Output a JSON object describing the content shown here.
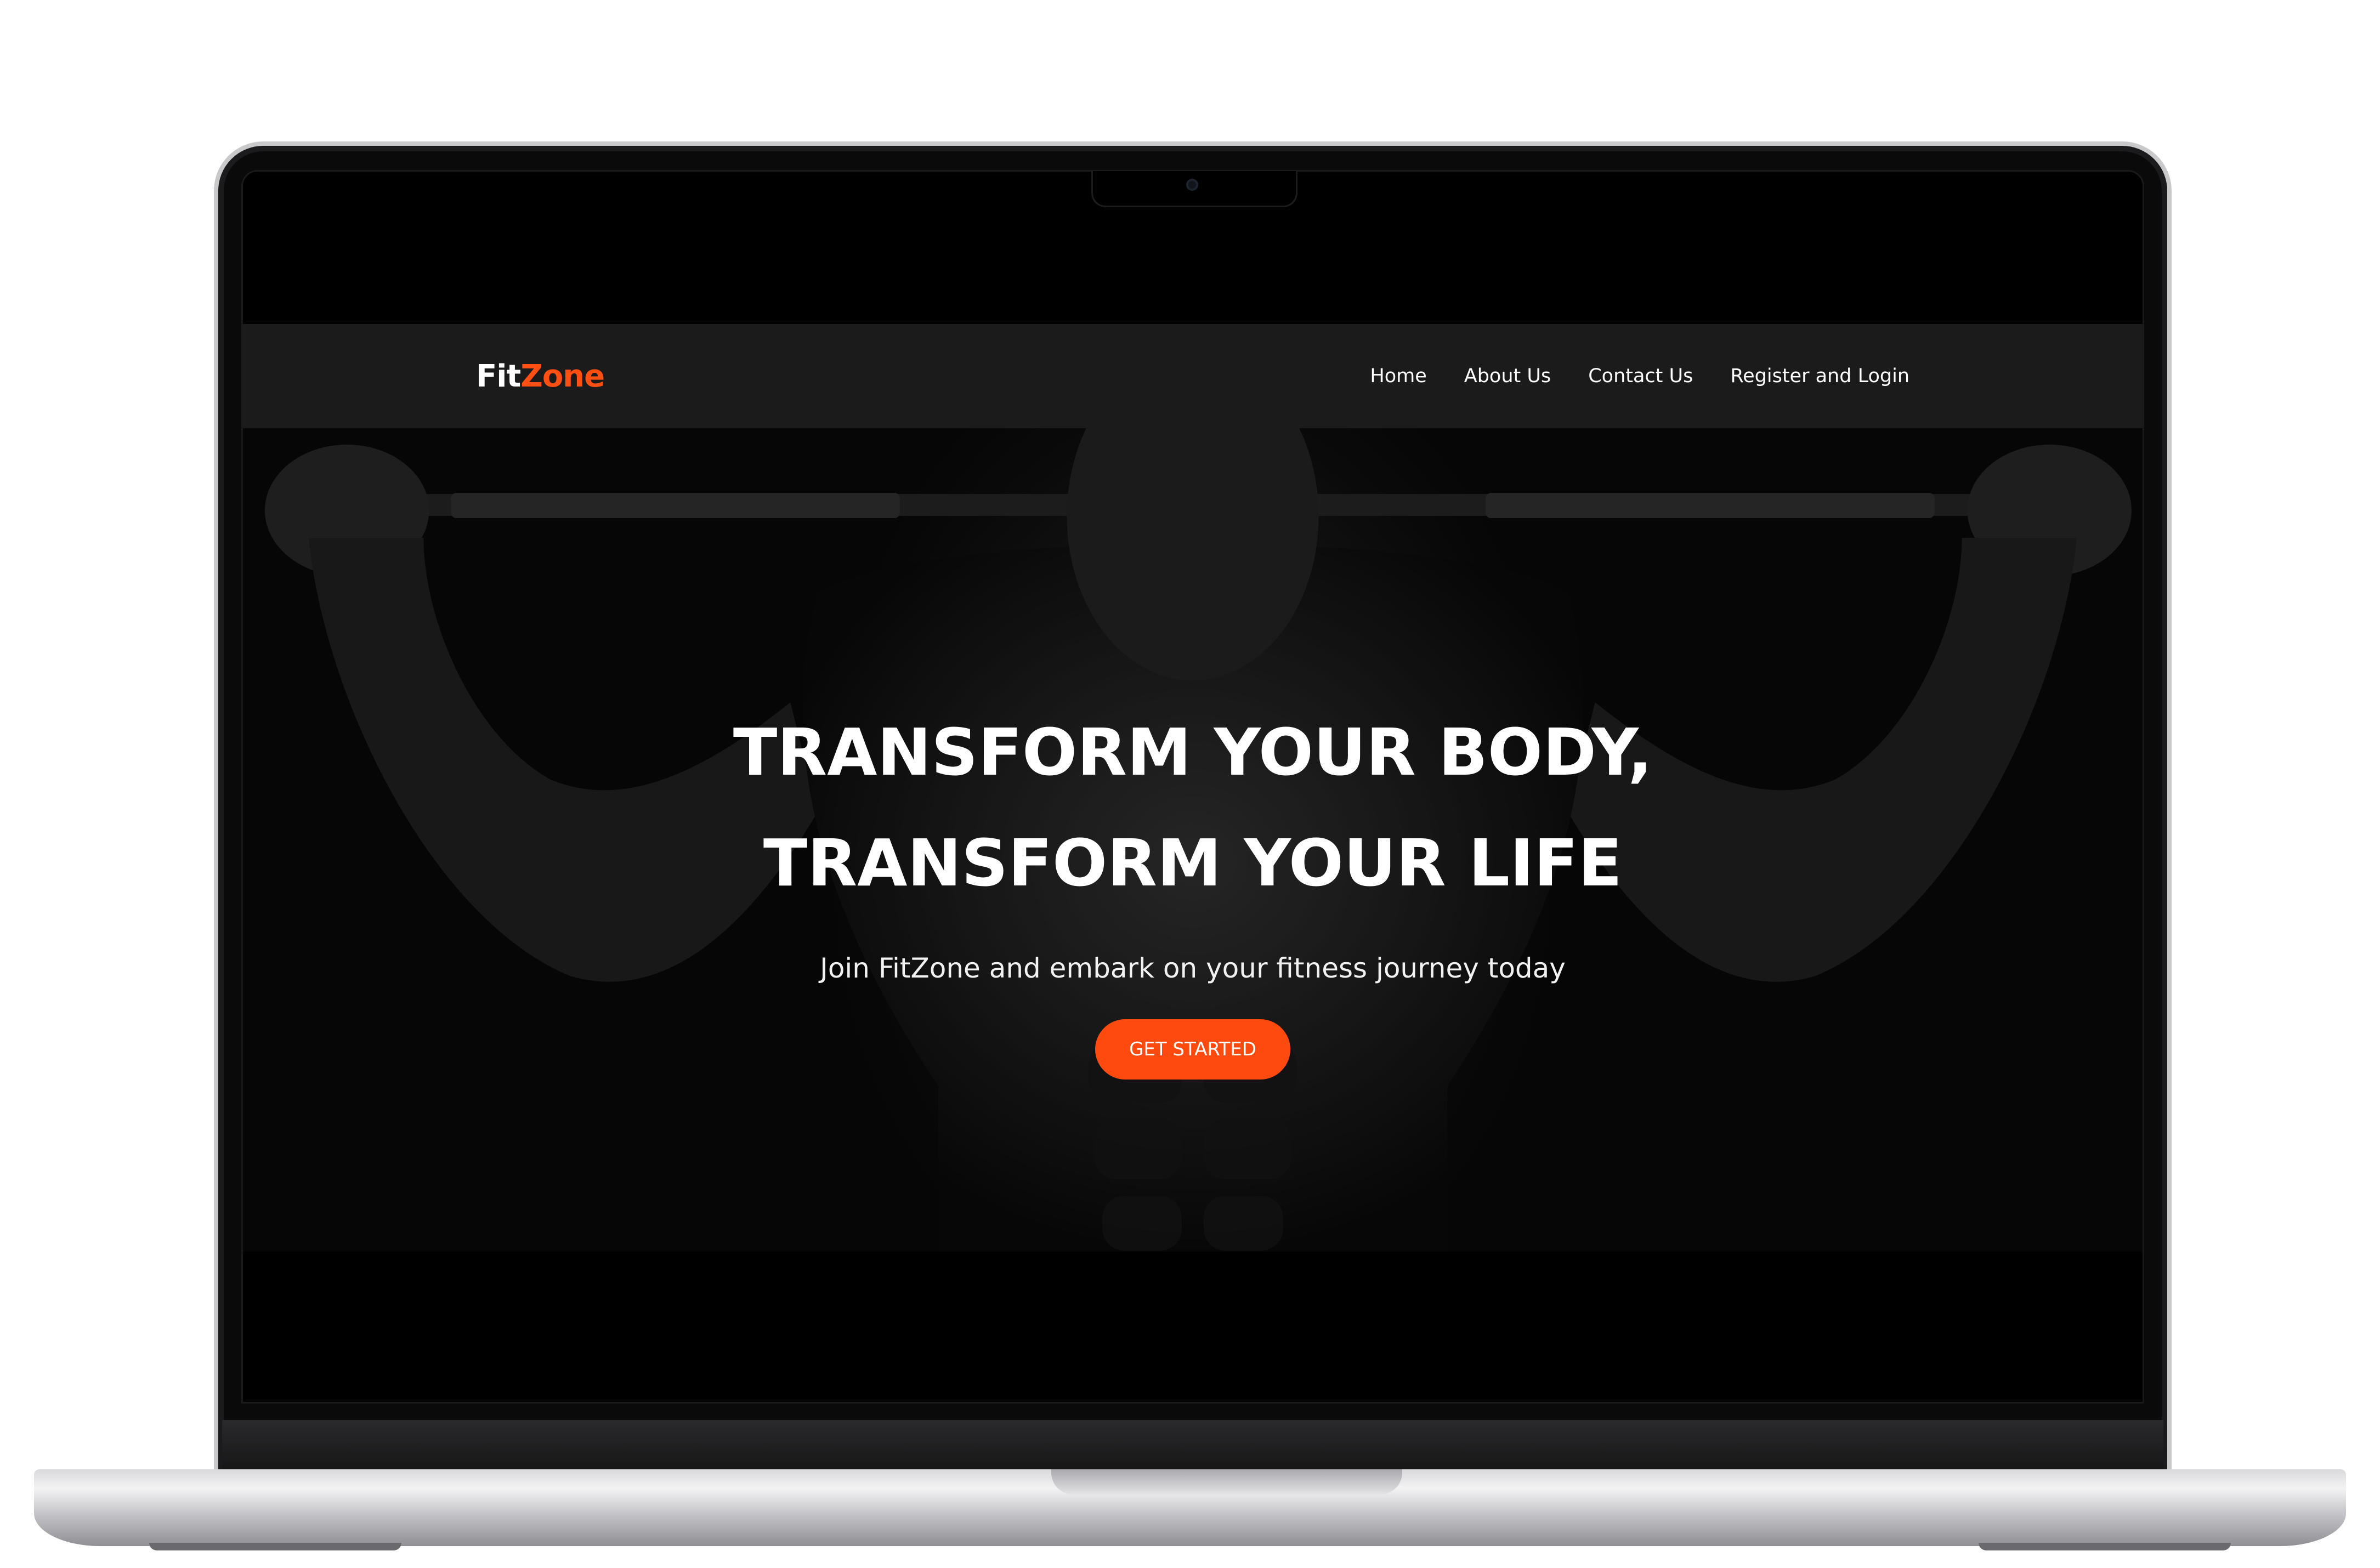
{
  "brand": {
    "name_part1": "Fit",
    "name_part2": "Zone",
    "accent_color": "#ff4f12"
  },
  "nav": {
    "items": [
      {
        "label": "Home"
      },
      {
        "label": "About Us"
      },
      {
        "label": "Contact Us"
      },
      {
        "label": "Register and Login"
      }
    ]
  },
  "hero": {
    "title_line1": "TRANSFORM YOUR BODY,",
    "title_line2": "TRANSFORM YOUR LIFE",
    "subtitle": "Join FitZone and embark on your fitness journey today",
    "cta_label": "GET STARTED",
    "cta_color": "#ff4a0f",
    "background_image": "muscular-man-barbell-photo"
  }
}
